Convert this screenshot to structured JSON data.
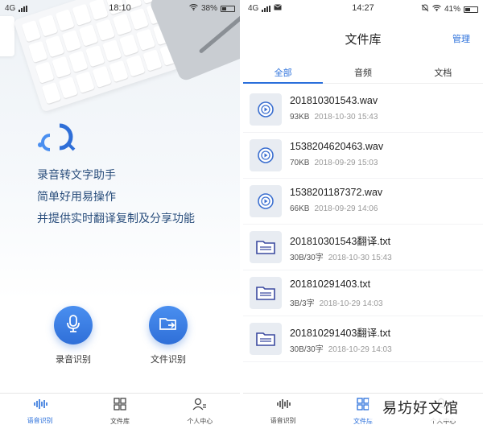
{
  "left_screen": {
    "status": {
      "network": "4G",
      "time": "18:10",
      "battery": "38%"
    },
    "taglines": [
      "录音转文字助手",
      "简单好用易操作",
      "并提供实时翻译复制及分享功能"
    ],
    "actions": {
      "record_label": "录音识别",
      "files_label": "文件识别"
    },
    "nav": [
      "语音识别",
      "文件库",
      "个人中心"
    ]
  },
  "right_screen": {
    "status": {
      "network": "4G",
      "time": "14:27",
      "battery": "41%"
    },
    "title": "文件库",
    "manage_label": "管理",
    "tabs": [
      "全部",
      "音频",
      "文档"
    ],
    "files": [
      {
        "name": "201810301543.wav",
        "size": "93KB",
        "date": "2018-10-30 15:43",
        "icon": "audio-file-icon"
      },
      {
        "name": "1538204620463.wav",
        "size": "70KB",
        "date": "2018-09-29 15:03",
        "icon": "audio-file-icon"
      },
      {
        "name": "1538201187372.wav",
        "size": "66KB",
        "date": "2018-09-29 14:06",
        "icon": "audio-file-icon"
      },
      {
        "name": "201810301543翻译.txt",
        "size": "30B/30字",
        "date": "2018-10-30 15:43",
        "icon": "folder-icon"
      },
      {
        "name": "201810291403.txt",
        "size": "3B/3字",
        "date": "2018-10-29 14:03",
        "icon": "folder-icon"
      },
      {
        "name": "201810291403翻译.txt",
        "size": "30B/30字",
        "date": "2018-10-29 14:03",
        "icon": "folder-icon"
      }
    ],
    "nav": [
      "语音识别",
      "文件库",
      "个人中心"
    ],
    "watermark": "易坊好文馆"
  },
  "colors": {
    "accent": "#2a6fdb",
    "tagline": "#2a4e7c",
    "icon_bg": "#e8ecf2"
  }
}
